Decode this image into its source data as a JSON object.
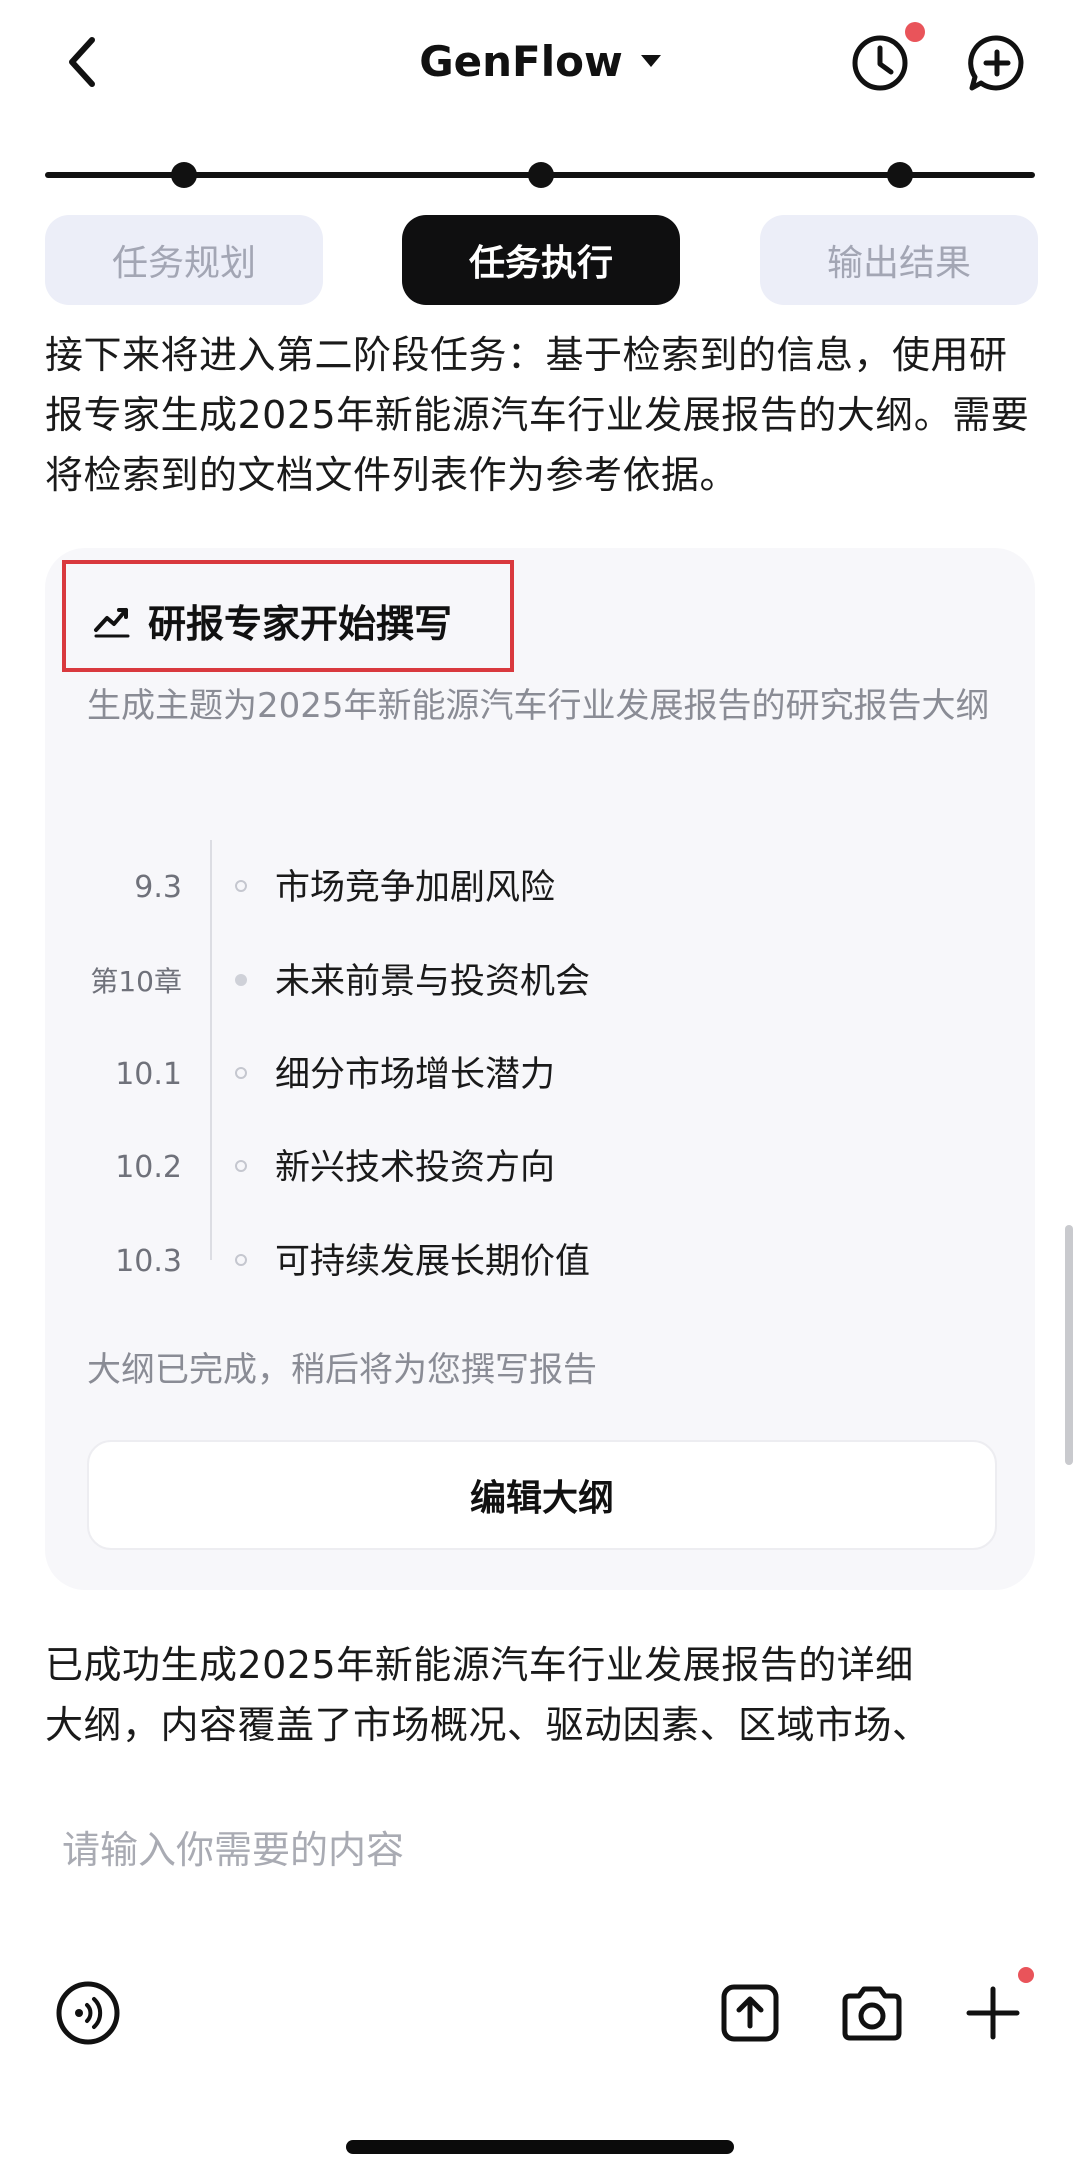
{
  "header": {
    "title": "GenFlow",
    "history_has_notification": true,
    "icons": [
      "back-icon",
      "chevron-down-icon",
      "history-clock-icon",
      "new-chat-icon"
    ]
  },
  "progress": {
    "steps": 3,
    "completed": 3
  },
  "tabs": [
    {
      "label": "任务规划",
      "active": false
    },
    {
      "label": "任务执行",
      "active": true
    },
    {
      "label": "输出结果",
      "active": false
    }
  ],
  "intro_text": "接下来将进入第二阶段任务：基于检索到的信息，使用研报专家生成2025年新能源汽车行业发展报告的大纲。需要将检索到的文档文件列表作为参考依据。",
  "card": {
    "title": "研报专家开始撰写",
    "title_icon": "trend-chart-icon",
    "subtitle": "生成主题为2025年新能源汽车行业发展报告的研究报告大纲",
    "outline": [
      {
        "num": "9.3",
        "text": "市场竞争加剧风险",
        "is_chapter": false
      },
      {
        "num": "第10章",
        "text": "未来前景与投资机会",
        "is_chapter": true
      },
      {
        "num": "10.1",
        "text": "细分市场增长潜力",
        "is_chapter": false
      },
      {
        "num": "10.2",
        "text": "新兴技术投资方向",
        "is_chapter": false
      },
      {
        "num": "10.3",
        "text": "可持续发展长期价值",
        "is_chapter": false
      }
    ],
    "note": "大纲已完成，稍后将为您撰写报告",
    "edit_button": "编辑大纲"
  },
  "result_text_line1": "已成功生成2025年新能源汽车行业发展报告的详细",
  "result_text_line2": "大纲，内容覆盖了市场概况、驱动因素、区域市场、",
  "input": {
    "placeholder": "请输入你需要的内容"
  },
  "bottom_icons": [
    "voice-call-icon",
    "upload-icon",
    "camera-icon",
    "plus-icon"
  ],
  "colors": {
    "accent_dark": "#0f0f10",
    "notification_red": "#e9545a",
    "highlight_red": "#d9393e"
  }
}
